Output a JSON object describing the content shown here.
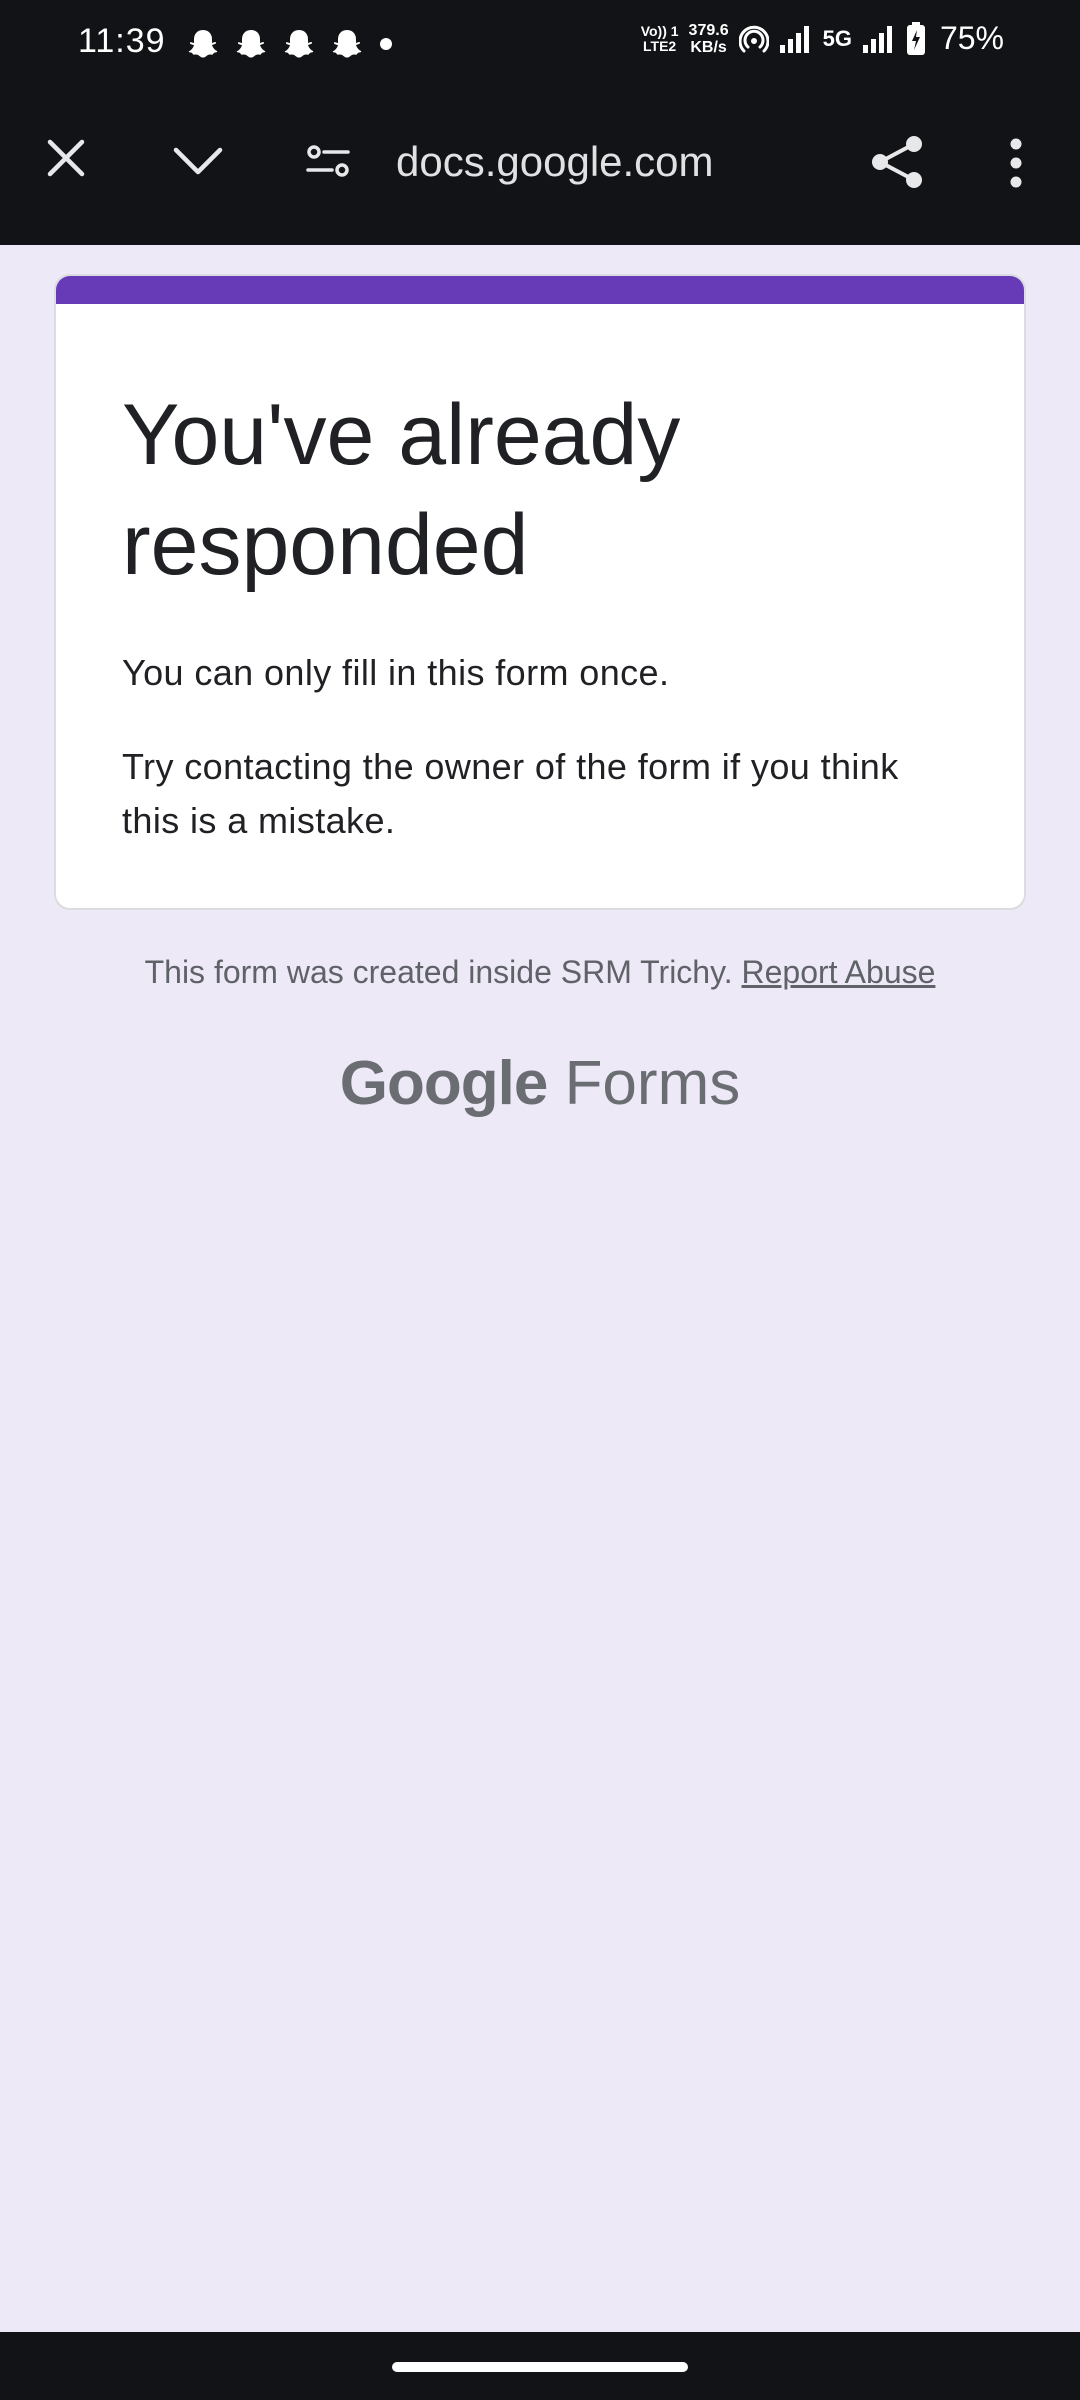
{
  "status_bar": {
    "time": "11:39",
    "volte_line1": "Vo)) 1",
    "volte_line2": "LTE2",
    "net_speed_value": "379.6",
    "net_speed_unit": "KB/s",
    "network_type": "5G",
    "battery": "75%",
    "notification_icons": [
      "snapchat-icon",
      "snapchat-icon",
      "snapchat-icon",
      "snapchat-icon"
    ]
  },
  "toolbar": {
    "url": "docs.google.com",
    "icons": [
      "close-icon",
      "chevron-down-icon",
      "site-settings-icon",
      "share-icon",
      "more-vert-icon"
    ]
  },
  "card": {
    "title": "You've already responded",
    "message": "You can only fill in this form once.",
    "hint": "Try contacting the owner of the form if you think this is a mistake.",
    "accent_color": "#673ab7"
  },
  "footer": {
    "note": "This form was created inside SRM Trichy.",
    "report_link": "Report Abuse"
  },
  "brand": {
    "google": "Google",
    "product": "Forms"
  }
}
